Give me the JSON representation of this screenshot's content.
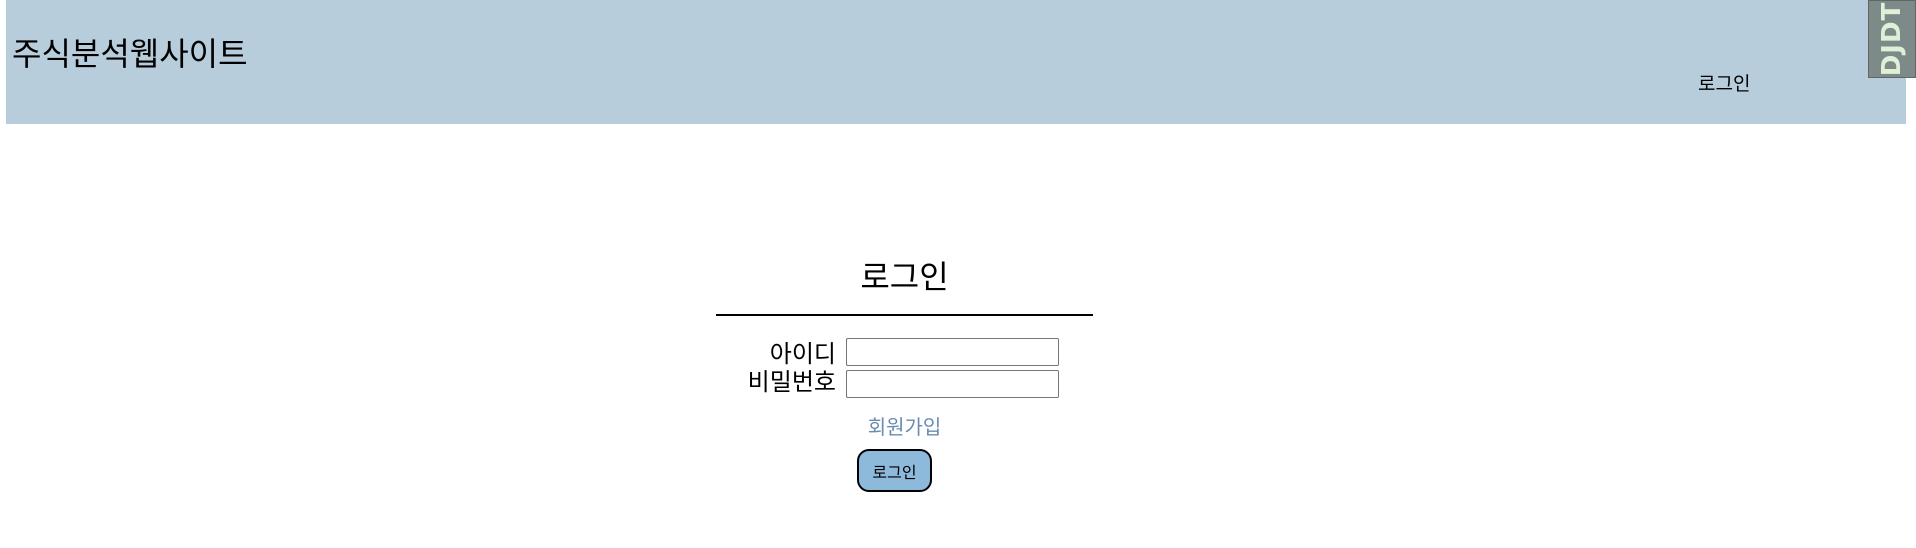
{
  "header": {
    "site_title": "주식분석웹사이트",
    "login_link": "로그인",
    "background_color": "#b7cddc"
  },
  "extension_badge": {
    "text": "DJDT"
  },
  "login_form": {
    "title": "로그인",
    "id_label": "아이디",
    "id_value": "",
    "password_label": "비밀번호",
    "password_value": "",
    "signup_link": "회원가입",
    "submit_label": "로그인",
    "button_color": "#8db9db",
    "link_color": "#6b8cae"
  }
}
